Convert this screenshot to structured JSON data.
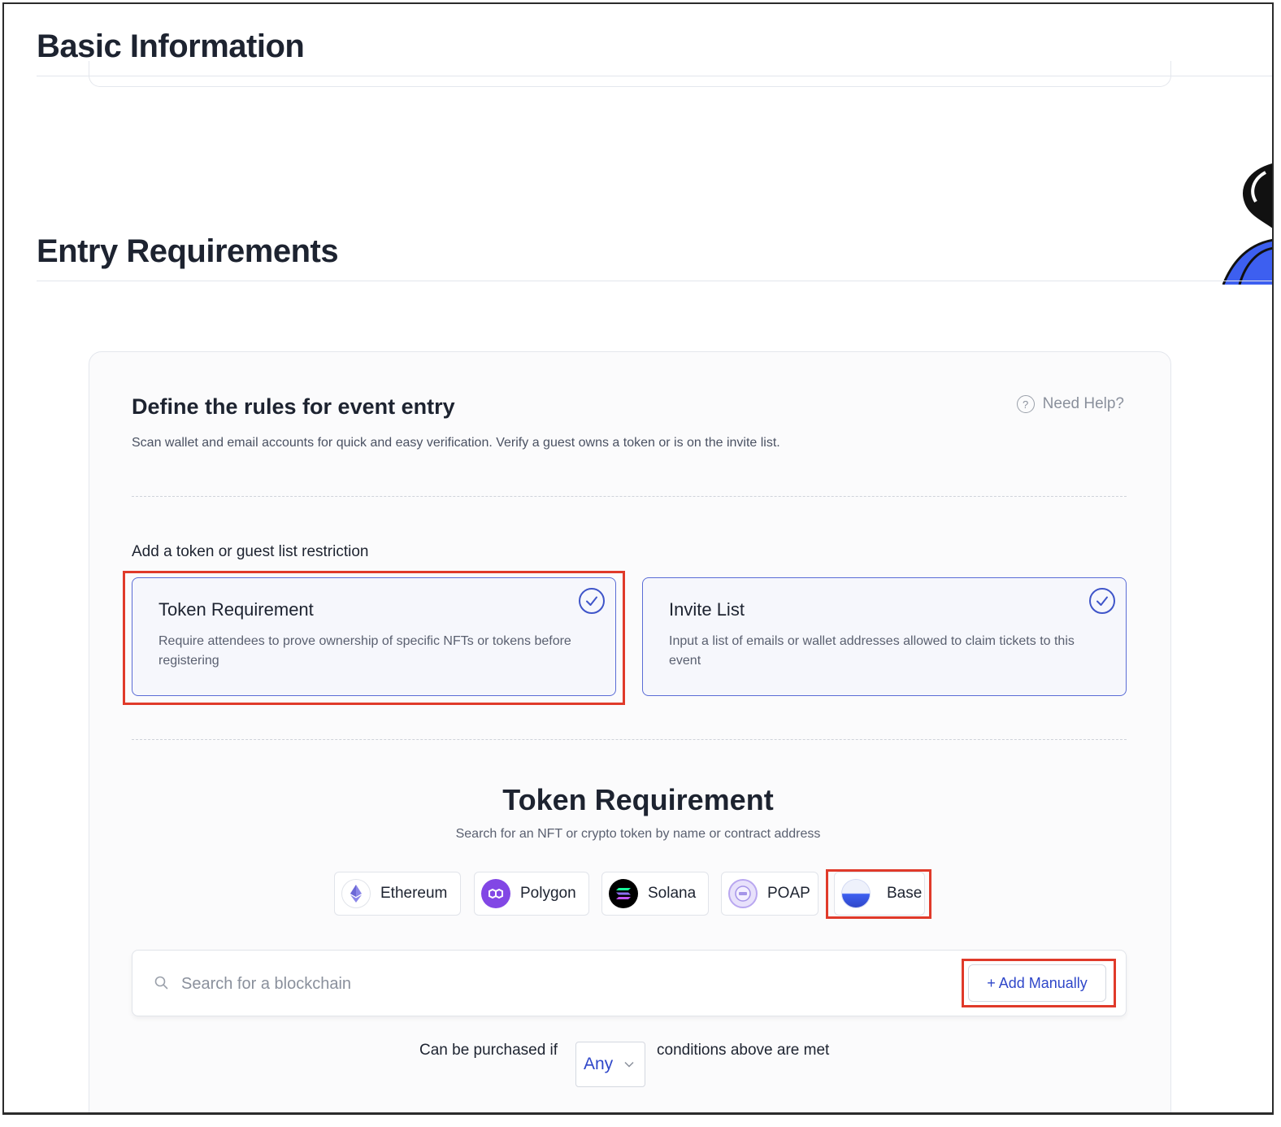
{
  "basic_info": {
    "title": "Basic Information"
  },
  "entry": {
    "title": "Entry Requirements",
    "card_title": "Define the rules for event entry",
    "card_subtitle": "Scan wallet and email accounts for quick and easy verification. Verify a guest owns a token or is on the invite list.",
    "help_label": "Need Help?",
    "restriction_label": "Add a token or guest list restriction",
    "options": [
      {
        "title": "Token Requirement",
        "description": "Require attendees to prove ownership of specific NFTs or tokens before registering",
        "selected": true
      },
      {
        "title": "Invite List",
        "description": "Input a list of emails or wallet addresses allowed to claim tickets to this event",
        "selected": true
      }
    ]
  },
  "token_requirement": {
    "title": "Token Requirement",
    "subtitle": "Search for an NFT or crypto token by name or contract address",
    "chains": [
      {
        "label": "Ethereum",
        "icon": "ethereum-icon"
      },
      {
        "label": "Polygon",
        "icon": "polygon-icon"
      },
      {
        "label": "Solana",
        "icon": "solana-icon"
      },
      {
        "label": "POAP",
        "icon": "poap-icon"
      },
      {
        "label": "Base",
        "icon": "base-icon"
      }
    ],
    "search": {
      "placeholder": "Search for a blockchain",
      "value": ""
    },
    "add_manually": "+ Add Manually",
    "condition": {
      "prefix": "Can be purchased if",
      "value": "Any",
      "suffix": "conditions above are met"
    }
  },
  "colors": {
    "accent": "#2f47c9",
    "highlight": "#e03a2a",
    "card_border": "#5a6cd6"
  }
}
